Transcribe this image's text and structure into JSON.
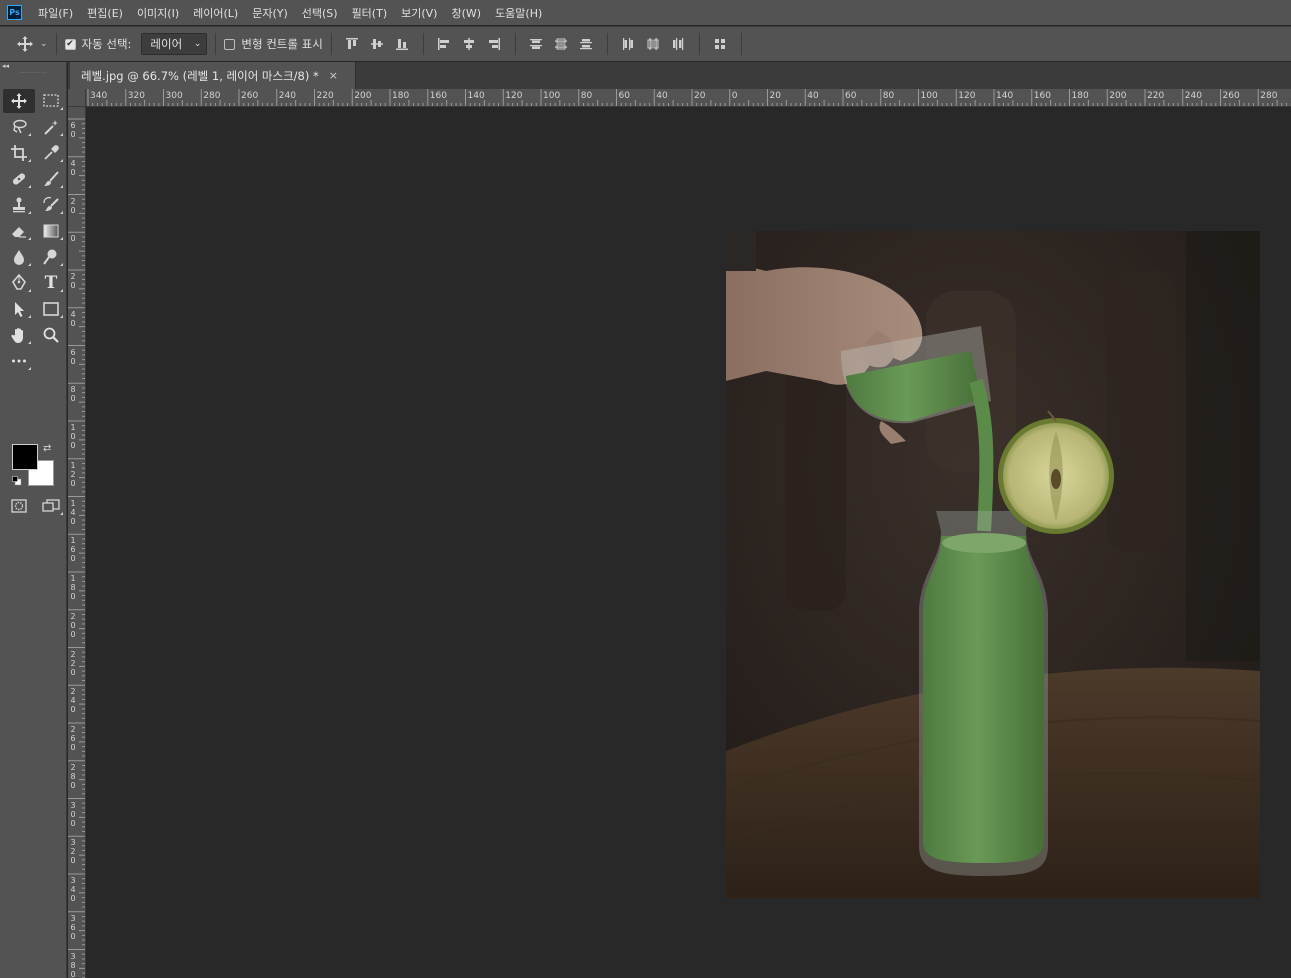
{
  "app": {
    "logo_text": "Ps",
    "menu": [
      "파일(F)",
      "편집(E)",
      "이미지(I)",
      "레이어(L)",
      "문자(Y)",
      "선택(S)",
      "필터(T)",
      "보기(V)",
      "창(W)",
      "도움말(H)"
    ]
  },
  "options": {
    "move_icon": "move-arrows-icon",
    "auto_select_label": "자동 선택:",
    "auto_select_checked": true,
    "target_value": "레이어",
    "transform_label": "변형 컨트롤 표시",
    "transform_checked": false
  },
  "tabs": [
    {
      "title": "레벨.jpg @ 66.7% (레벨 1, 레이어 마스크/8) *",
      "close": "×"
    }
  ],
  "rulers": {
    "top_labels": [
      "340",
      "320",
      "300",
      "280",
      "260",
      "240",
      "220",
      "200",
      "180",
      "160",
      "140",
      "120",
      "100",
      "80",
      "60",
      "40",
      "20",
      "0",
      "20",
      "40",
      "60",
      "80",
      "100",
      "120",
      "140",
      "160",
      "180",
      "200",
      "220",
      "240",
      "260",
      "280"
    ],
    "left_labels": [
      "60",
      "40",
      "20",
      "0",
      "20",
      "40",
      "60",
      "80",
      "100",
      "120",
      "140",
      "160",
      "180",
      "200",
      "220",
      "240",
      "260",
      "280",
      "300",
      "320",
      "340",
      "360",
      "380"
    ]
  },
  "colors": {
    "foreground": "#000000",
    "background": "#ffffff",
    "accent": "#31a8ff"
  },
  "tools": [
    "move-tool-icon",
    "marquee-tool-icon",
    "lasso-tool-icon",
    "magic-wand-tool-icon",
    "crop-tool-icon",
    "eyedropper-tool-icon",
    "healing-brush-tool-icon",
    "brush-tool-icon",
    "clone-stamp-tool-icon",
    "history-brush-tool-icon",
    "eraser-tool-icon",
    "gradient-tool-icon",
    "blur-tool-icon",
    "dodge-tool-icon",
    "pen-tool-icon",
    "type-tool-icon",
    "path-selection-tool-icon",
    "rectangle-tool-icon",
    "hand-tool-icon",
    "zoom-tool-icon",
    "more-tools-icon"
  ],
  "type_tool_glyph": "T"
}
